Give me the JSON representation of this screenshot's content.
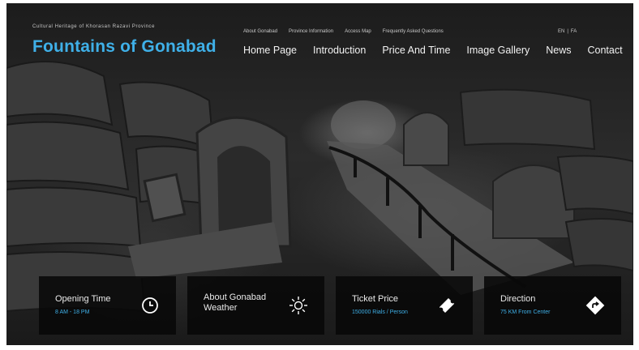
{
  "header": {
    "subtitle": "Cultural Heritage of Khorasan Razavi Province",
    "title": "Fountains of Gonabad",
    "top_links": [
      "About Gonabad",
      "Province Information",
      "Access Map",
      "Frequently Asked Questions"
    ],
    "languages": [
      "EN",
      "FA"
    ],
    "language_separator": "|",
    "nav": [
      "Home Page",
      "Introduction",
      "Price And Time",
      "Image Gallery",
      "News",
      "Contact"
    ]
  },
  "cards": [
    {
      "title": "Opening Time",
      "subtitle": "8 AM - 18 PM",
      "icon": "clock-icon"
    },
    {
      "title": "About Gonabad Weather",
      "subtitle": "",
      "icon": "sun-icon"
    },
    {
      "title": "Ticket Price",
      "subtitle": "150000 Rials / Person",
      "icon": "ticket-icon"
    },
    {
      "title": "Direction",
      "subtitle": "75 KM From Center",
      "icon": "direction-icon"
    }
  ],
  "colors": {
    "accent": "#3fb0e8",
    "card_bg": "#080808"
  }
}
